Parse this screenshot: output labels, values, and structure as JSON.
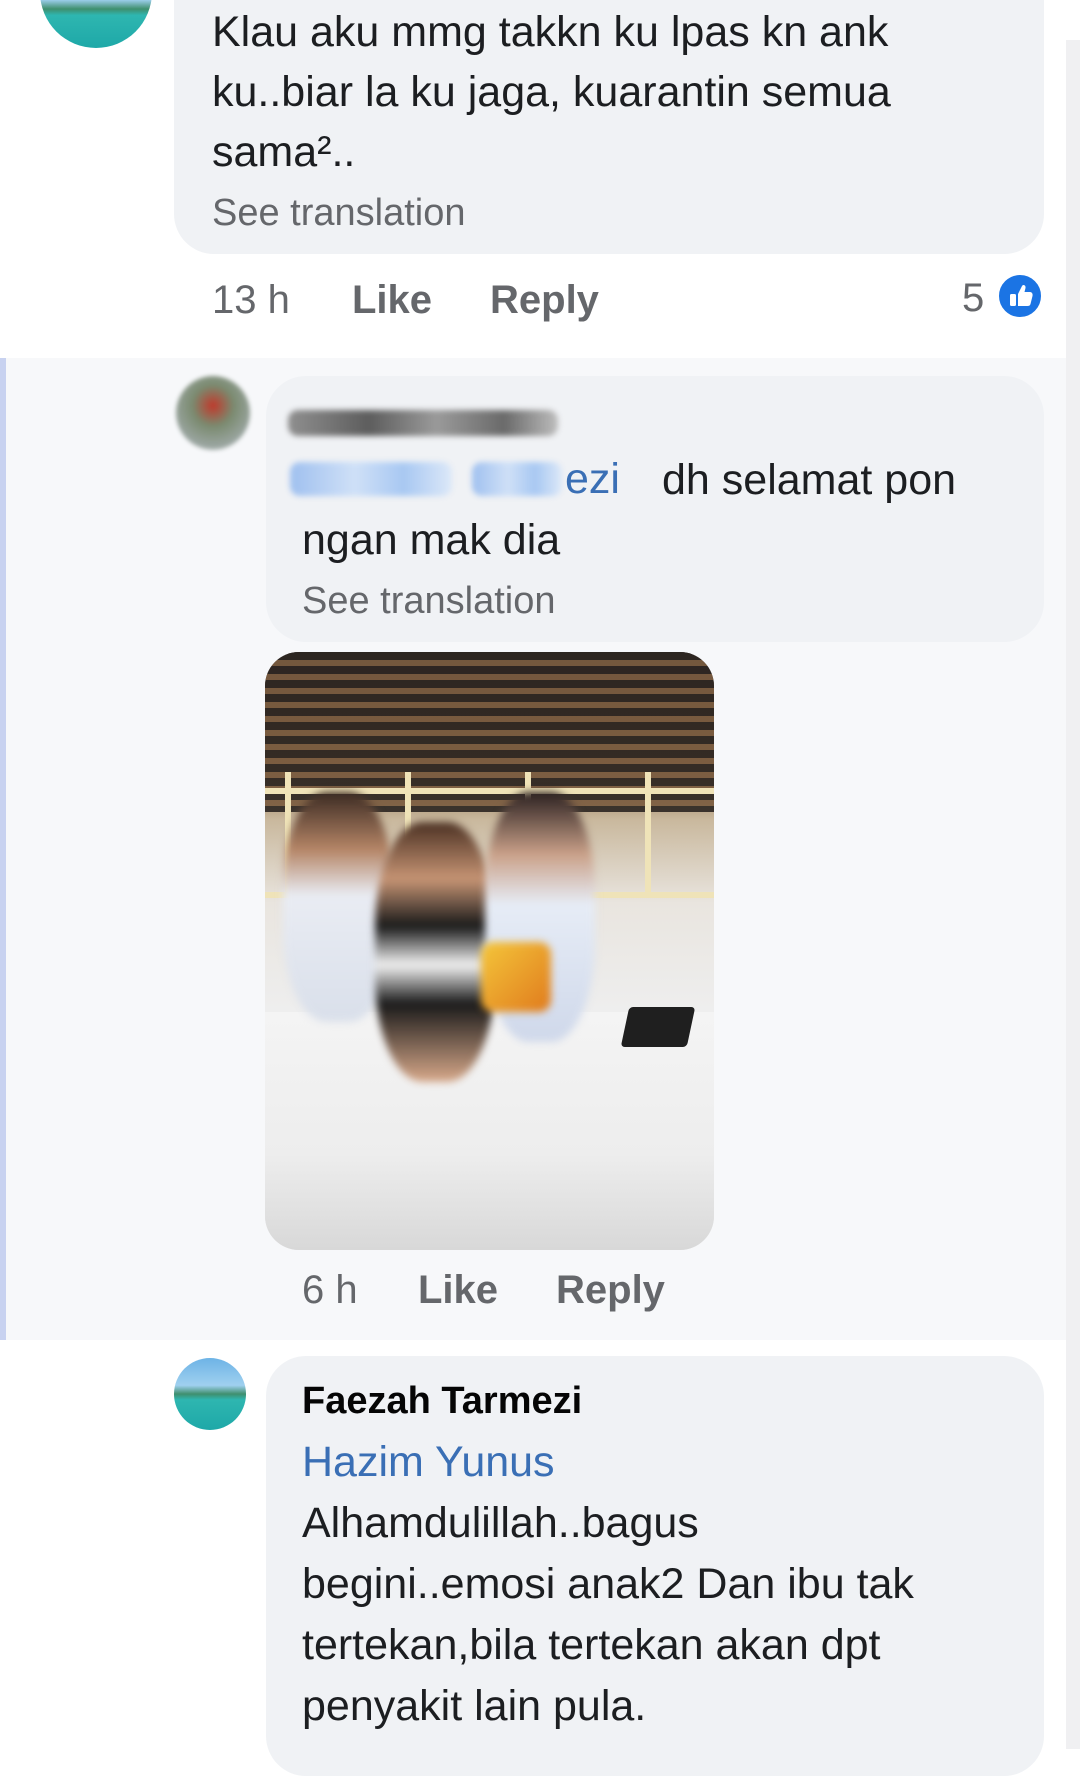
{
  "comments": [
    {
      "text_lines": [
        "Klau aku mmg takkn ku lpas kn ank",
        "ku..biar la ku jaga, kuarantin semua",
        "sama².."
      ],
      "see_translation": "See translation",
      "time": "13 h",
      "like_label": "Like",
      "reply_label": "Reply",
      "reaction_count": "5"
    },
    {
      "mention_suffix": "ezi",
      "text_first": "dh selamat pon",
      "text_second": "ngan mak dia",
      "see_translation": "See translation",
      "time": "6 h",
      "like_label": "Like",
      "reply_label": "Reply"
    },
    {
      "author": "Faezah Tarmezi",
      "mention": "Hazim Yunus",
      "text_lines": [
        "Alhamdulillah..bagus",
        "begini..emosi anak2 Dan ibu tak",
        "tertekan,bila tertekan akan dpt",
        "penyakit lain pula."
      ]
    }
  ],
  "icons": {
    "reaction": "like-thumb-icon"
  },
  "colors": {
    "bubble": "#f0f2f5",
    "mention": "#3a6fb5",
    "meta": "#65676b",
    "like_icon": "#1b74e4"
  }
}
